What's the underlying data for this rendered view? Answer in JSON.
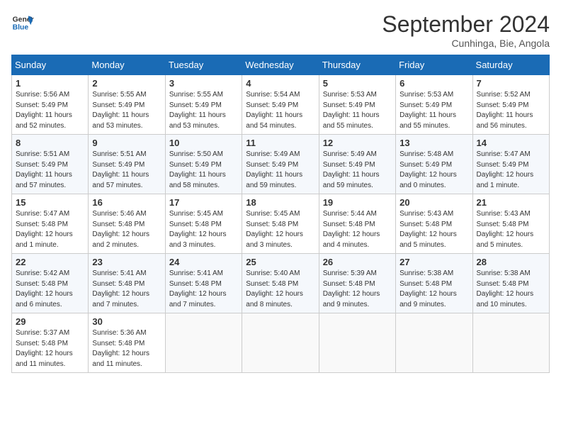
{
  "header": {
    "logo_line1": "General",
    "logo_line2": "Blue",
    "month": "September 2024",
    "location": "Cunhinga, Bie, Angola"
  },
  "weekdays": [
    "Sunday",
    "Monday",
    "Tuesday",
    "Wednesday",
    "Thursday",
    "Friday",
    "Saturday"
  ],
  "weeks": [
    [
      {
        "day": "1",
        "info": "Sunrise: 5:56 AM\nSunset: 5:49 PM\nDaylight: 11 hours\nand 52 minutes."
      },
      {
        "day": "2",
        "info": "Sunrise: 5:55 AM\nSunset: 5:49 PM\nDaylight: 11 hours\nand 53 minutes."
      },
      {
        "day": "3",
        "info": "Sunrise: 5:55 AM\nSunset: 5:49 PM\nDaylight: 11 hours\nand 53 minutes."
      },
      {
        "day": "4",
        "info": "Sunrise: 5:54 AM\nSunset: 5:49 PM\nDaylight: 11 hours\nand 54 minutes."
      },
      {
        "day": "5",
        "info": "Sunrise: 5:53 AM\nSunset: 5:49 PM\nDaylight: 11 hours\nand 55 minutes."
      },
      {
        "day": "6",
        "info": "Sunrise: 5:53 AM\nSunset: 5:49 PM\nDaylight: 11 hours\nand 55 minutes."
      },
      {
        "day": "7",
        "info": "Sunrise: 5:52 AM\nSunset: 5:49 PM\nDaylight: 11 hours\nand 56 minutes."
      }
    ],
    [
      {
        "day": "8",
        "info": "Sunrise: 5:51 AM\nSunset: 5:49 PM\nDaylight: 11 hours\nand 57 minutes."
      },
      {
        "day": "9",
        "info": "Sunrise: 5:51 AM\nSunset: 5:49 PM\nDaylight: 11 hours\nand 57 minutes."
      },
      {
        "day": "10",
        "info": "Sunrise: 5:50 AM\nSunset: 5:49 PM\nDaylight: 11 hours\nand 58 minutes."
      },
      {
        "day": "11",
        "info": "Sunrise: 5:49 AM\nSunset: 5:49 PM\nDaylight: 11 hours\nand 59 minutes."
      },
      {
        "day": "12",
        "info": "Sunrise: 5:49 AM\nSunset: 5:49 PM\nDaylight: 11 hours\nand 59 minutes."
      },
      {
        "day": "13",
        "info": "Sunrise: 5:48 AM\nSunset: 5:49 PM\nDaylight: 12 hours\nand 0 minutes."
      },
      {
        "day": "14",
        "info": "Sunrise: 5:47 AM\nSunset: 5:49 PM\nDaylight: 12 hours\nand 1 minute."
      }
    ],
    [
      {
        "day": "15",
        "info": "Sunrise: 5:47 AM\nSunset: 5:48 PM\nDaylight: 12 hours\nand 1 minute."
      },
      {
        "day": "16",
        "info": "Sunrise: 5:46 AM\nSunset: 5:48 PM\nDaylight: 12 hours\nand 2 minutes."
      },
      {
        "day": "17",
        "info": "Sunrise: 5:45 AM\nSunset: 5:48 PM\nDaylight: 12 hours\nand 3 minutes."
      },
      {
        "day": "18",
        "info": "Sunrise: 5:45 AM\nSunset: 5:48 PM\nDaylight: 12 hours\nand 3 minutes."
      },
      {
        "day": "19",
        "info": "Sunrise: 5:44 AM\nSunset: 5:48 PM\nDaylight: 12 hours\nand 4 minutes."
      },
      {
        "day": "20",
        "info": "Sunrise: 5:43 AM\nSunset: 5:48 PM\nDaylight: 12 hours\nand 5 minutes."
      },
      {
        "day": "21",
        "info": "Sunrise: 5:43 AM\nSunset: 5:48 PM\nDaylight: 12 hours\nand 5 minutes."
      }
    ],
    [
      {
        "day": "22",
        "info": "Sunrise: 5:42 AM\nSunset: 5:48 PM\nDaylight: 12 hours\nand 6 minutes."
      },
      {
        "day": "23",
        "info": "Sunrise: 5:41 AM\nSunset: 5:48 PM\nDaylight: 12 hours\nand 7 minutes."
      },
      {
        "day": "24",
        "info": "Sunrise: 5:41 AM\nSunset: 5:48 PM\nDaylight: 12 hours\nand 7 minutes."
      },
      {
        "day": "25",
        "info": "Sunrise: 5:40 AM\nSunset: 5:48 PM\nDaylight: 12 hours\nand 8 minutes."
      },
      {
        "day": "26",
        "info": "Sunrise: 5:39 AM\nSunset: 5:48 PM\nDaylight: 12 hours\nand 9 minutes."
      },
      {
        "day": "27",
        "info": "Sunrise: 5:38 AM\nSunset: 5:48 PM\nDaylight: 12 hours\nand 9 minutes."
      },
      {
        "day": "28",
        "info": "Sunrise: 5:38 AM\nSunset: 5:48 PM\nDaylight: 12 hours\nand 10 minutes."
      }
    ],
    [
      {
        "day": "29",
        "info": "Sunrise: 5:37 AM\nSunset: 5:48 PM\nDaylight: 12 hours\nand 11 minutes."
      },
      {
        "day": "30",
        "info": "Sunrise: 5:36 AM\nSunset: 5:48 PM\nDaylight: 12 hours\nand 11 minutes."
      },
      {
        "day": "",
        "info": ""
      },
      {
        "day": "",
        "info": ""
      },
      {
        "day": "",
        "info": ""
      },
      {
        "day": "",
        "info": ""
      },
      {
        "day": "",
        "info": ""
      }
    ]
  ]
}
